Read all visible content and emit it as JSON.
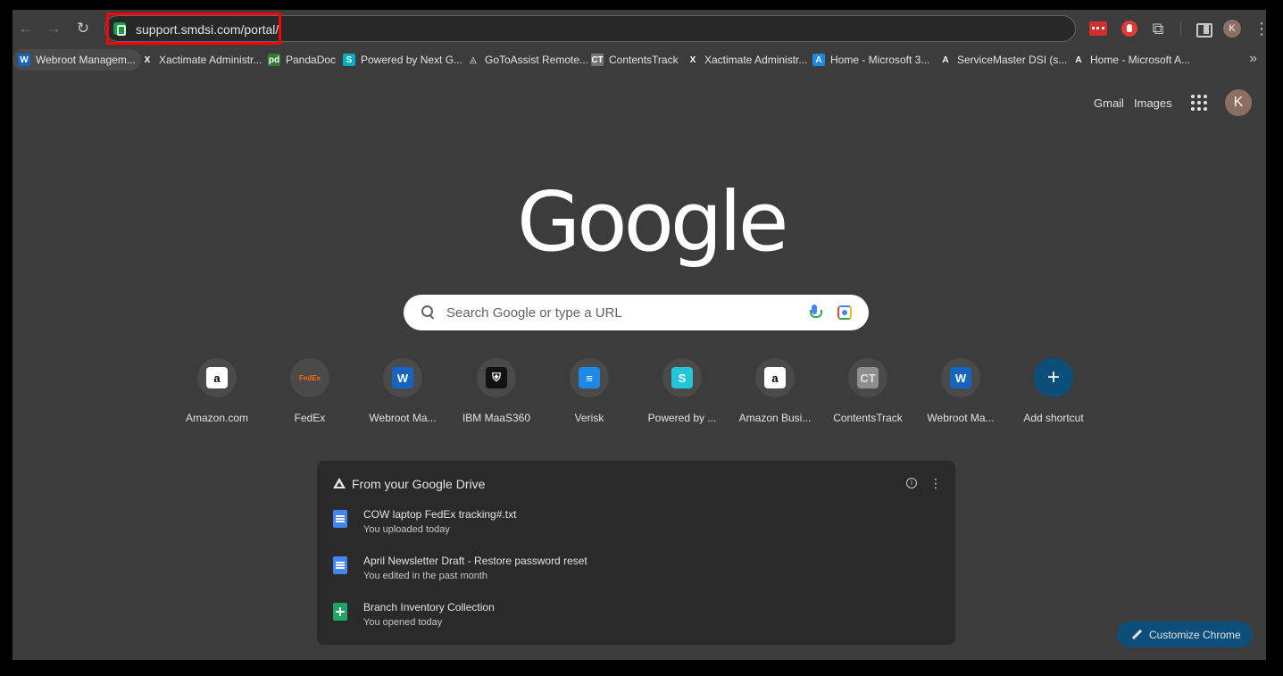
{
  "browser": {
    "url": "support.smdsi.com/portal/",
    "nav": {
      "back": "←",
      "forward": "→",
      "reload": "↻"
    },
    "toolbar_avatar": "K",
    "bookmarks_more": "»"
  },
  "bookmarks": [
    {
      "label": "Webroot Managem...",
      "fav": "W",
      "color": "#1565c0"
    },
    {
      "label": "Xactimate Administr...",
      "fav": "X",
      "color": "#3c3c3c"
    },
    {
      "label": "PandaDoc",
      "fav": "pd",
      "color": "#2e7d32"
    },
    {
      "label": "Powered by Next G...",
      "fav": "S",
      "color": "#00acc1"
    },
    {
      "label": "GoToAssist Remote...",
      "fav": "◬",
      "color": "#3c3c3c"
    },
    {
      "label": "ContentsTrack",
      "fav": "CT",
      "color": "#757575"
    },
    {
      "label": "Xactimate Administr...",
      "fav": "X",
      "color": "#3c3c3c"
    },
    {
      "label": "Home - Microsoft 3...",
      "fav": "A",
      "color": "#1e88e5"
    },
    {
      "label": "ServiceMaster DSI (s...",
      "fav": "A",
      "color": "#3c3c3c"
    },
    {
      "label": "Home - Microsoft A...",
      "fav": "A",
      "color": "#3c3c3c"
    }
  ],
  "header": {
    "gmail": "Gmail",
    "images": "Images",
    "account": "K"
  },
  "logo": "Google",
  "search": {
    "placeholder": "Search Google or type a URL"
  },
  "shortcuts": [
    {
      "label": "Amazon.com",
      "glyph": "a",
      "bg": "#ffffff",
      "fg": "#000000"
    },
    {
      "label": "FedEx",
      "glyph": "FedEx",
      "bg": "transparent",
      "fg": "#ff6600"
    },
    {
      "label": "Webroot Ma...",
      "glyph": "W",
      "bg": "#1565c0",
      "fg": "#ffffff"
    },
    {
      "label": "IBM MaaS360",
      "glyph": "⛨",
      "bg": "#111111",
      "fg": "#ffffff"
    },
    {
      "label": "Verisk",
      "glyph": "≡",
      "bg": "#1e88e5",
      "fg": "#ffffff"
    },
    {
      "label": "Powered by ...",
      "glyph": "S",
      "bg": "#26c6da",
      "fg": "#ffffff"
    },
    {
      "label": "Amazon Busi...",
      "glyph": "a",
      "bg": "#ffffff",
      "fg": "#000000"
    },
    {
      "label": "ContentsTrack",
      "glyph": "CT",
      "bg": "#8e8e8e",
      "fg": "#e0e0e0"
    },
    {
      "label": "Webroot Ma...",
      "glyph": "W",
      "bg": "#1565c0",
      "fg": "#ffffff"
    },
    {
      "label": "Add shortcut",
      "glyph": "+",
      "bg": "",
      "fg": "#ffffff"
    }
  ],
  "drive": {
    "title": "From your Google Drive",
    "files": [
      {
        "name": "COW laptop FedEx tracking#.txt",
        "meta": "You uploaded today",
        "type": "doc"
      },
      {
        "name": "April Newsletter Draft - Restore password reset",
        "meta": "You edited in the past month",
        "type": "doc"
      },
      {
        "name": "Branch Inventory Collection",
        "meta": "You opened today",
        "type": "sheet"
      }
    ]
  },
  "customize": {
    "label": "Customize Chrome"
  }
}
